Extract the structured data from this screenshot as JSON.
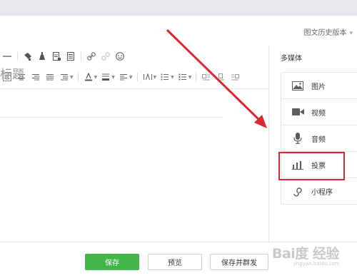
{
  "header": {
    "version_history_label": "图文历史版本"
  },
  "editor": {
    "title_placeholder": "标题"
  },
  "toolbar": {
    "row1_icons": [
      "horizontal-rule-icon",
      "format-painter-icon",
      "clear-format-icon",
      "template-icon",
      "document-icon",
      "link-icon",
      "unlink-icon",
      "emoji-icon"
    ],
    "row2_icons": [
      "align-left-icon",
      "align-center-icon",
      "align-right-icon",
      "justify-icon",
      "indent-icon",
      "font-color-icon",
      "background-color-icon",
      "line-height-icon",
      "letter-spacing-icon",
      "unordered-list-icon",
      "ordered-list-icon",
      "image-float-left-icon",
      "image-float-center-icon",
      "image-float-right-icon"
    ]
  },
  "sidebar": {
    "title": "多媒体",
    "items": [
      {
        "label": "图片",
        "icon": "image-icon"
      },
      {
        "label": "视频",
        "icon": "video-icon"
      },
      {
        "label": "音频",
        "icon": "microphone-icon"
      },
      {
        "label": "投票",
        "icon": "bar-chart-icon"
      },
      {
        "label": "小程序",
        "icon": "mini-program-icon"
      }
    ]
  },
  "footer": {
    "save_label": "保存",
    "preview_label": "预览",
    "save_and_send_label": "保存并群发"
  },
  "watermark": {
    "main": "Bai度 经验",
    "sub": "jingyan.baidu.com"
  },
  "colors": {
    "primary_green": "#44b549",
    "annotation_red": "#e0252e",
    "border": "#e7e7eb"
  }
}
